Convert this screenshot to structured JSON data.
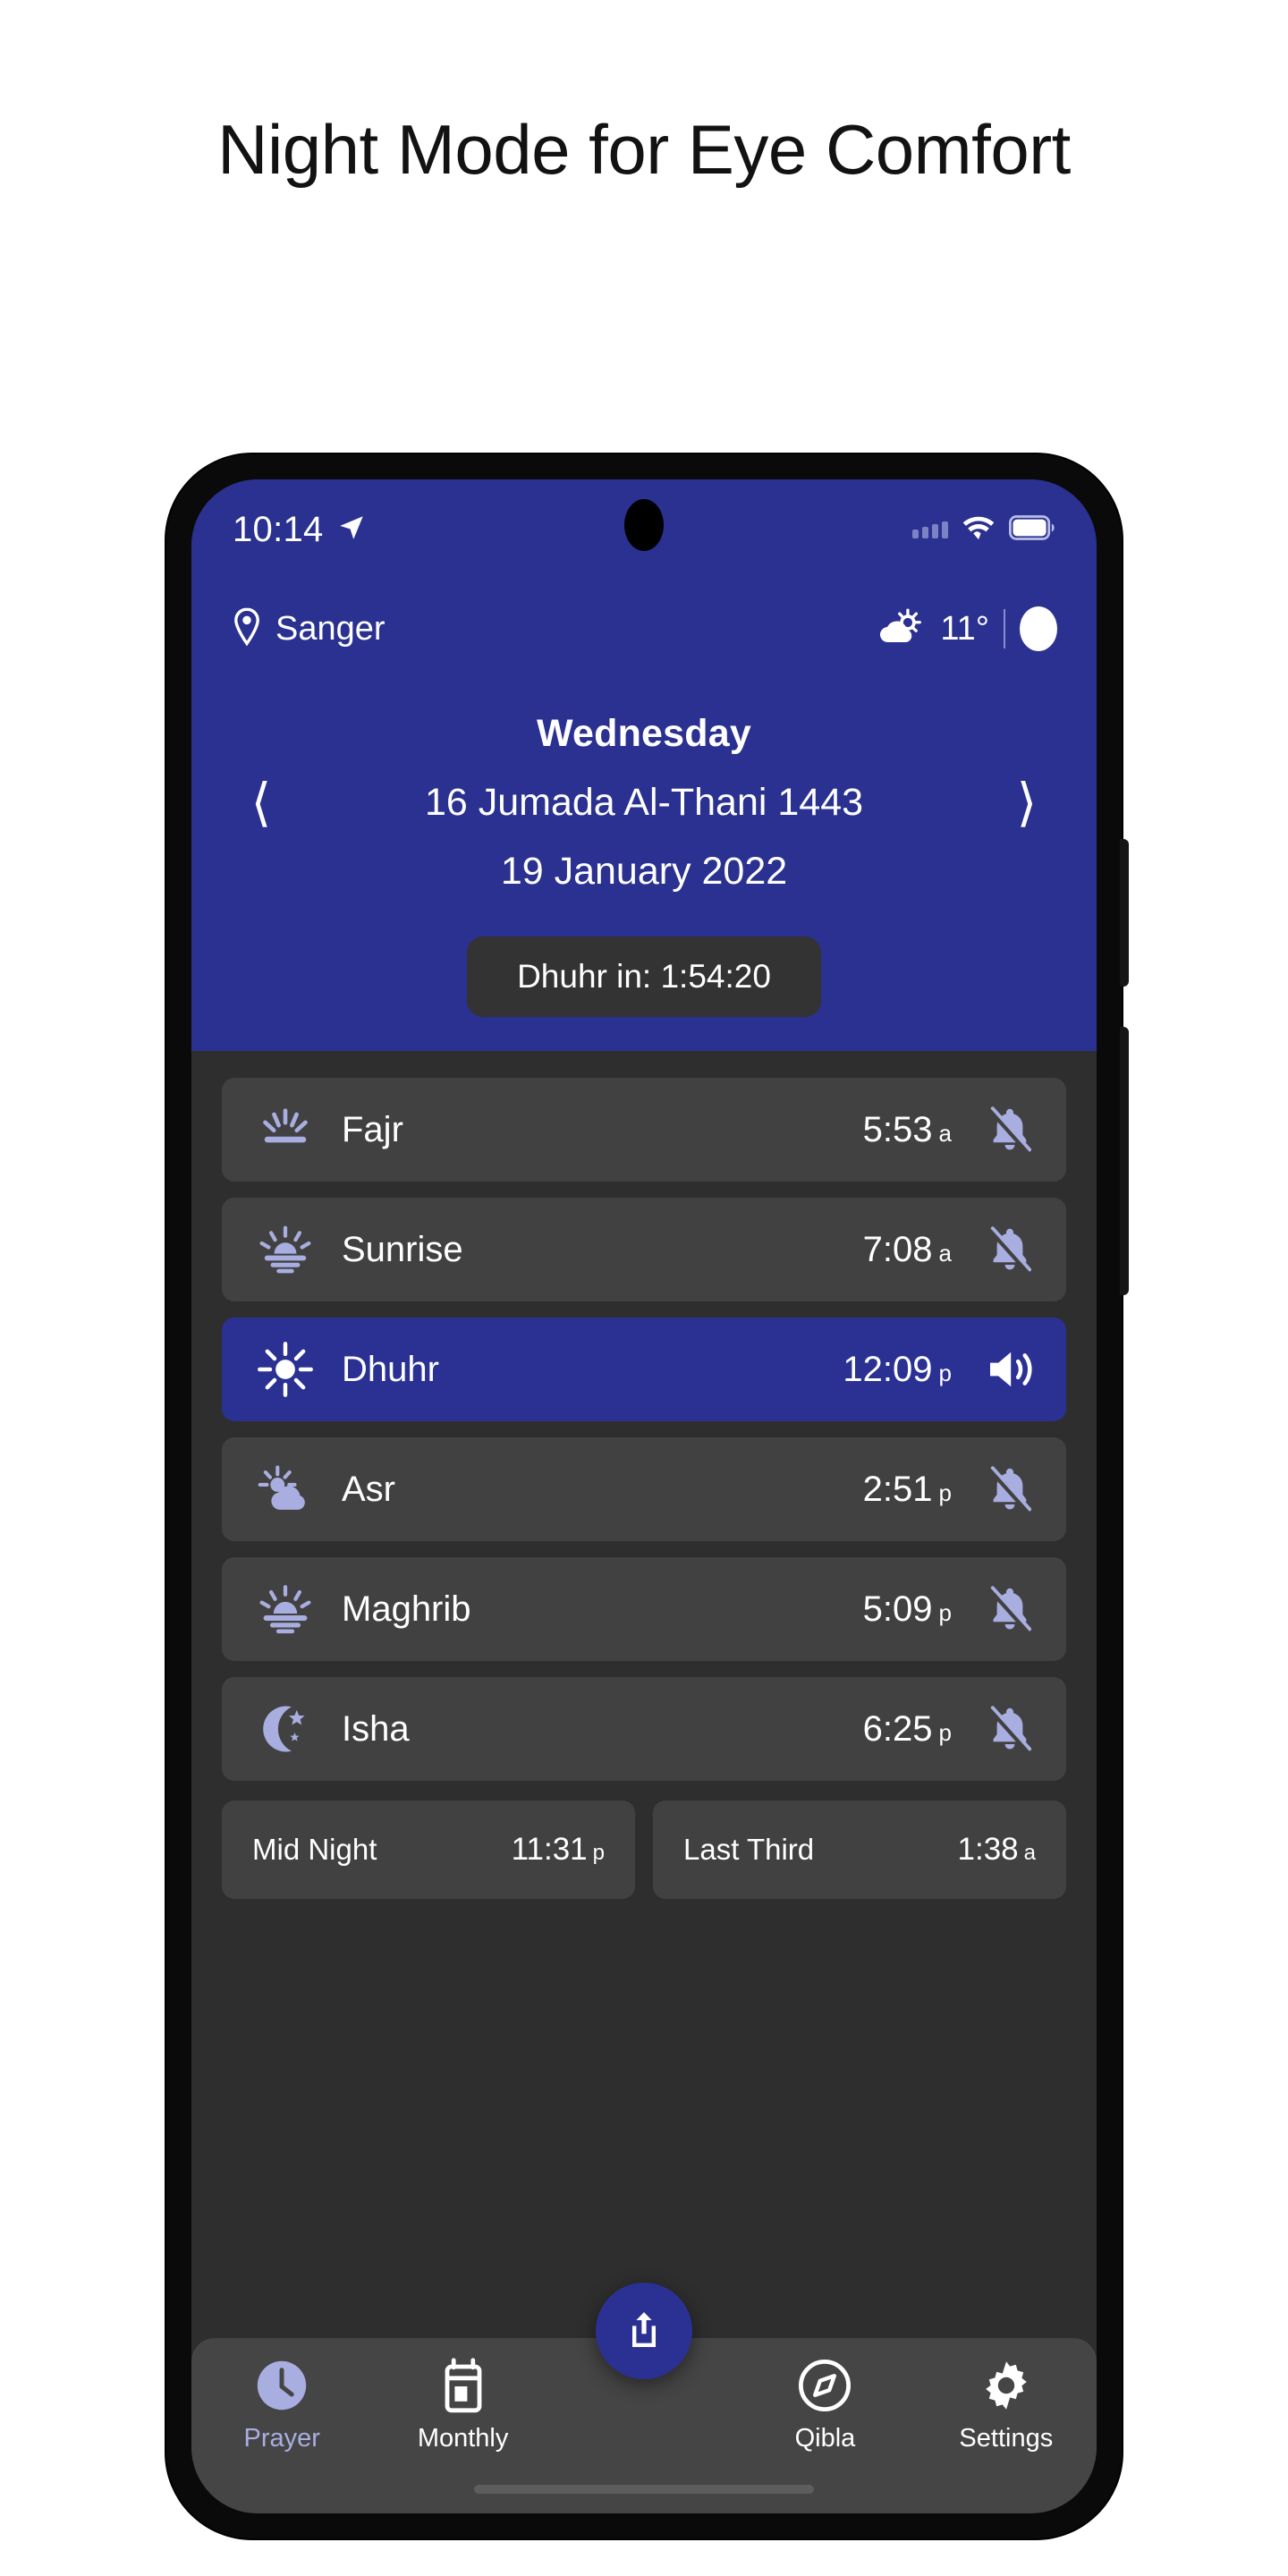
{
  "promo": {
    "title": "Night Mode for Eye Comfort"
  },
  "colors": {
    "brand_blue": "#2A3190",
    "card_dark": "#414141",
    "body_dark": "#2E2E2E",
    "nav_dark": "#454545",
    "accent_periwinkle": "#A9AEE0",
    "countdown_pill": "#333333"
  },
  "statusbar": {
    "time": "10:14",
    "location_icon": "navigation-arrow-icon",
    "signal_icon": "signal-dots-icon",
    "wifi_icon": "wifi-icon",
    "battery_icon": "battery-full-icon"
  },
  "header": {
    "location_icon": "map-pin-icon",
    "location": "Sanger",
    "weather_icon": "sun-behind-cloud-icon",
    "temperature": "11°",
    "theme_toggle_icon": "half-moon-icon",
    "prev_icon": "chevron-left-icon",
    "next_icon": "chevron-right-icon",
    "weekday": "Wednesday",
    "hijri_date": "16 Jumada Al-Thani 1443",
    "gregorian_date": "19 January 2022",
    "countdown": "Dhuhr in: 1:54:20"
  },
  "prayers": [
    {
      "name": "Fajr",
      "time": "5:53",
      "meridiem": "a",
      "icon": "dawn-rays-icon",
      "alarm_icon": "bell-off-icon",
      "active": false
    },
    {
      "name": "Sunrise",
      "time": "7:08",
      "meridiem": "a",
      "icon": "sunrise-icon",
      "alarm_icon": "bell-off-icon",
      "active": false
    },
    {
      "name": "Dhuhr",
      "time": "12:09",
      "meridiem": "p",
      "icon": "sun-icon",
      "alarm_icon": "speaker-on-icon",
      "active": true
    },
    {
      "name": "Asr",
      "time": "2:51",
      "meridiem": "p",
      "icon": "sun-behind-cloud-icon",
      "alarm_icon": "bell-off-icon",
      "active": false
    },
    {
      "name": "Maghrib",
      "time": "5:09",
      "meridiem": "p",
      "icon": "sunset-icon",
      "alarm_icon": "bell-off-icon",
      "active": false
    },
    {
      "name": "Isha",
      "time": "6:25",
      "meridiem": "p",
      "icon": "crescent-stars-icon",
      "alarm_icon": "bell-off-icon",
      "active": false
    }
  ],
  "extras": [
    {
      "label": "Mid Night",
      "time": "11:31",
      "meridiem": "p"
    },
    {
      "label": "Last Third",
      "time": "1:38",
      "meridiem": "a"
    }
  ],
  "bottomnav": {
    "items": [
      {
        "label": "Prayer",
        "icon": "clock-icon",
        "active": true
      },
      {
        "label": "Monthly",
        "icon": "calendar-icon",
        "active": false
      },
      {
        "label": "Qibla",
        "icon": "compass-icon",
        "active": false
      },
      {
        "label": "Settings",
        "icon": "gear-icon",
        "active": false
      }
    ],
    "fab_icon": "share-icon"
  }
}
